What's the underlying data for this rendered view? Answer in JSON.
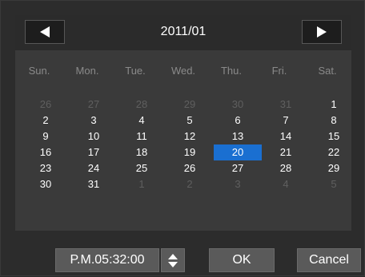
{
  "header": {
    "title": "2011/01",
    "prev_icon": "left-triangle-icon",
    "next_icon": "right-triangle-icon"
  },
  "weekdays": [
    "Sun.",
    "Mon.",
    "Tue.",
    "Wed.",
    "Thu.",
    "Fri.",
    "Sat."
  ],
  "weeks": [
    [
      {
        "d": "26",
        "muted": true
      },
      {
        "d": "27",
        "muted": true
      },
      {
        "d": "28",
        "muted": true
      },
      {
        "d": "29",
        "muted": true
      },
      {
        "d": "30",
        "muted": true
      },
      {
        "d": "31",
        "muted": true
      },
      {
        "d": "1",
        "muted": false
      }
    ],
    [
      {
        "d": "2",
        "muted": false
      },
      {
        "d": "3",
        "muted": false
      },
      {
        "d": "4",
        "muted": false
      },
      {
        "d": "5",
        "muted": false
      },
      {
        "d": "6",
        "muted": false
      },
      {
        "d": "7",
        "muted": false
      },
      {
        "d": "8",
        "muted": false
      }
    ],
    [
      {
        "d": "9",
        "muted": false
      },
      {
        "d": "10",
        "muted": false
      },
      {
        "d": "11",
        "muted": false
      },
      {
        "d": "12",
        "muted": false
      },
      {
        "d": "13",
        "muted": false
      },
      {
        "d": "14",
        "muted": false
      },
      {
        "d": "15",
        "muted": false
      }
    ],
    [
      {
        "d": "16",
        "muted": false
      },
      {
        "d": "17",
        "muted": false
      },
      {
        "d": "18",
        "muted": false
      },
      {
        "d": "19",
        "muted": false
      },
      {
        "d": "20",
        "muted": false,
        "selected": true
      },
      {
        "d": "21",
        "muted": false
      },
      {
        "d": "22",
        "muted": false
      }
    ],
    [
      {
        "d": "23",
        "muted": false
      },
      {
        "d": "24",
        "muted": false
      },
      {
        "d": "25",
        "muted": false
      },
      {
        "d": "26",
        "muted": false
      },
      {
        "d": "27",
        "muted": false
      },
      {
        "d": "28",
        "muted": false
      },
      {
        "d": "29",
        "muted": false
      }
    ],
    [
      {
        "d": "30",
        "muted": false
      },
      {
        "d": "31",
        "muted": false
      },
      {
        "d": "1",
        "muted": true
      },
      {
        "d": "2",
        "muted": true
      },
      {
        "d": "3",
        "muted": true
      },
      {
        "d": "4",
        "muted": true
      },
      {
        "d": "5",
        "muted": true
      }
    ]
  ],
  "footer": {
    "time_value": "P.M.05:32:00",
    "ok_label": "OK",
    "cancel_label": "Cancel"
  },
  "colors": {
    "selected": "#1a6fd1",
    "background": "#2c2c2c",
    "calendar_body": "#3a3a3a"
  }
}
